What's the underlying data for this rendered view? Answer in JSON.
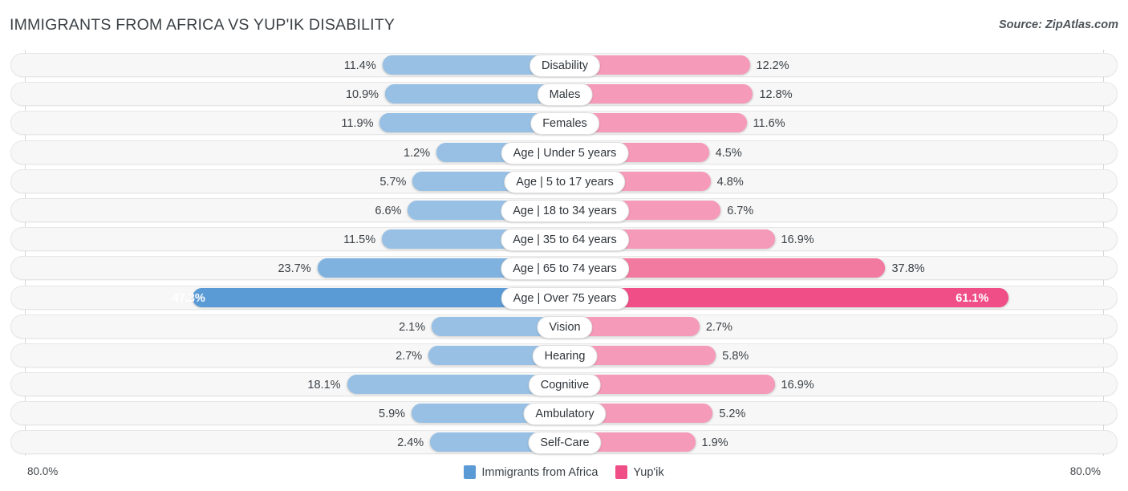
{
  "header": {
    "title": "IMMIGRANTS FROM AFRICA VS YUP'IK DISABILITY",
    "source": "Source: ZipAtlas.com"
  },
  "legend": {
    "items": [
      {
        "label": "Immigrants from Africa",
        "color": "#5b9bd5"
      },
      {
        "label": "Yup'ik",
        "color": "#ef4f86"
      }
    ]
  },
  "axis": {
    "left_label": "80.0%",
    "right_label": "80.0%",
    "max": 80.0
  },
  "colors": {
    "blue_light": "#97c0e4",
    "blue_mid": "#7fb2de",
    "blue_dark": "#5b9bd5",
    "pink_light": "#f59ab9",
    "pink_mid": "#f2799f",
    "pink_dark": "#ef4f86",
    "row_bg": "#f7f7f7",
    "row_border": "#e6e6e6"
  },
  "chart_data": {
    "type": "bar",
    "title": "IMMIGRANTS FROM AFRICA VS YUP'IK DISABILITY",
    "subtitle": "Source: ZipAtlas.com",
    "orientation": "horizontal-diverging",
    "xlabel": "",
    "ylabel": "",
    "xlim": [
      80.0,
      80.0
    ],
    "grid": false,
    "legend_position": "bottom-center",
    "categories": [
      "Disability",
      "Males",
      "Females",
      "Age | Under 5 years",
      "Age | 5 to 17 years",
      "Age | 18 to 34 years",
      "Age | 35 to 64 years",
      "Age | 65 to 74 years",
      "Age | Over 75 years",
      "Vision",
      "Hearing",
      "Cognitive",
      "Ambulatory",
      "Self-Care"
    ],
    "series": [
      {
        "name": "Immigrants from Africa",
        "color": "#5b9bd5",
        "side": "left",
        "values": [
          11.4,
          10.9,
          11.9,
          1.2,
          5.7,
          6.6,
          11.5,
          23.7,
          47.3,
          2.1,
          2.7,
          18.1,
          5.9,
          2.4
        ],
        "labels": [
          "11.4%",
          "10.9%",
          "11.9%",
          "1.2%",
          "5.7%",
          "6.6%",
          "11.5%",
          "23.7%",
          "47.3%",
          "2.1%",
          "2.7%",
          "18.1%",
          "5.9%",
          "2.4%"
        ]
      },
      {
        "name": "Yup'ik",
        "color": "#ef4f86",
        "side": "right",
        "values": [
          12.2,
          12.8,
          11.6,
          4.5,
          4.8,
          6.7,
          16.9,
          37.8,
          61.1,
          2.7,
          5.8,
          16.9,
          5.2,
          1.9
        ],
        "labels": [
          "12.2%",
          "12.8%",
          "11.6%",
          "4.5%",
          "4.8%",
          "6.7%",
          "16.9%",
          "37.8%",
          "61.1%",
          "2.7%",
          "5.8%",
          "16.9%",
          "5.2%",
          "1.9%"
        ]
      }
    ]
  }
}
